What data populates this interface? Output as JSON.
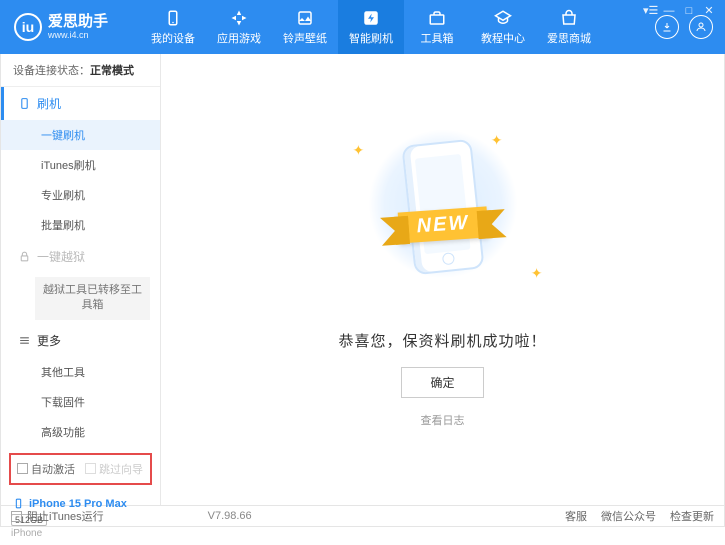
{
  "header": {
    "logo_title": "爱思助手",
    "logo_sub": "www.i4.cn",
    "nav": [
      {
        "label": "我的设备"
      },
      {
        "label": "应用游戏"
      },
      {
        "label": "铃声壁纸"
      },
      {
        "label": "智能刷机"
      },
      {
        "label": "工具箱"
      },
      {
        "label": "教程中心"
      },
      {
        "label": "爱思商城"
      }
    ]
  },
  "sidebar": {
    "status_label": "设备连接状态：",
    "status_value": "正常模式",
    "group_flash": "刷机",
    "subs_flash": [
      "一键刷机",
      "iTunes刷机",
      "专业刷机",
      "批量刷机"
    ],
    "group_jailbreak": "一键越狱",
    "jailbreak_notice": "越狱工具已转移至工具箱",
    "group_more": "更多",
    "subs_more": [
      "其他工具",
      "下载固件",
      "高级功能"
    ],
    "chk_auto_activate": "自动激活",
    "chk_skip_guide": "跳过向导",
    "device_name": "iPhone 15 Pro Max",
    "device_storage": "512GB",
    "device_type": "iPhone"
  },
  "main": {
    "ribbon": "NEW",
    "success": "恭喜您，保资料刷机成功啦！",
    "ok": "确定",
    "view_log": "查看日志"
  },
  "footer": {
    "block_itunes": "阻止iTunes运行",
    "version": "V7.98.66",
    "links": [
      "客服",
      "微信公众号",
      "检查更新"
    ]
  }
}
